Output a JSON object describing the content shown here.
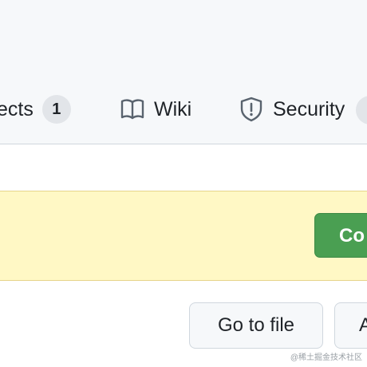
{
  "repo_nav": {
    "projects": {
      "label": "ects",
      "count": "1"
    },
    "wiki": {
      "label": "Wiki",
      "icon": "book-icon"
    },
    "security": {
      "label": "Security",
      "icon": "shield-icon"
    }
  },
  "banner": {
    "button_label": "Co"
  },
  "file_actions": {
    "go_to_file_label": "Go to file",
    "partial_button_label": "A"
  },
  "watermark": "@稀土掘金技术社区",
  "colors": {
    "header_bg": "#f6f8fa",
    "banner_bg": "#fff8c5",
    "primary_button": "#4a9f52"
  }
}
